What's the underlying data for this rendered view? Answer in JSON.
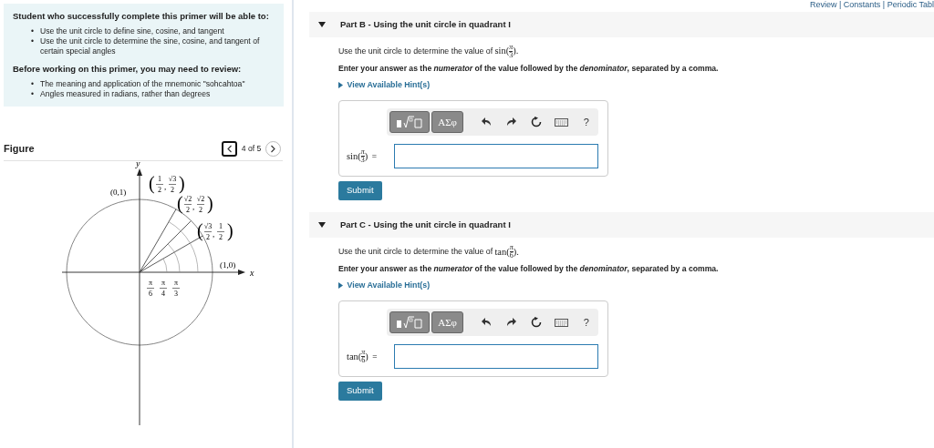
{
  "objectives": {
    "heading": "Student who successfully complete this primer will be able to:",
    "items": [
      {
        "bullet": "•",
        "text": "Use the unit circle to define sine, cosine, and tangent"
      },
      {
        "bullet": "•",
        "text": "Use the unit circle to determine the sine, cosine, and tangent of certain special angles"
      }
    ]
  },
  "review": {
    "heading": "Before working on this primer, you may need to review:",
    "items": [
      {
        "bullet": "•",
        "text": "The meaning and application of the mnemonic \"sohcahtoa\""
      },
      {
        "bullet": "•",
        "text": "Angles measured in radians, rather than degrees"
      }
    ]
  },
  "figure": {
    "title": "Figure",
    "pager": "4 of 5",
    "prev_focused": true,
    "axis_labels": {
      "x": "x",
      "y": "y"
    },
    "axis_points": [
      {
        "text": "(0,1)"
      },
      {
        "text": "(1,0)"
      }
    ],
    "points": [
      {
        "open": "(",
        "x_num": "1",
        "x_den": "2",
        "sep": ",",
        "y_num": "√3",
        "y_den": "2",
        "close": ")"
      },
      {
        "open": "(",
        "x_num": "√2",
        "x_den": "2",
        "sep": ",",
        "y_num": "√2",
        "y_den": "2",
        "close": ")"
      },
      {
        "open": "(",
        "x_num": "√3",
        "x_den": "2",
        "sep": ",",
        "y_num": "1",
        "y_den": "2",
        "close": ")"
      }
    ],
    "angles": [
      {
        "num": "π",
        "den": "6"
      },
      {
        "num": "π",
        "den": "4"
      },
      {
        "num": "π",
        "den": "3"
      }
    ]
  },
  "top_links": "Review | Constants | Periodic Tabl",
  "parts": [
    {
      "title": "Part B - Using the unit circle in quadrant I",
      "expanded": true,
      "prompt": "Use the unit circle to determine the value of",
      "prompt_math": {
        "func": "sin(",
        "num": "π",
        "den": "3",
        "close": ")."
      },
      "instruction": "Enter your answer as the *numerator* of the value followed by the *denominator*, separated by a comma.",
      "hint": "View Available Hint(s)",
      "symbols": "ΑΣφ",
      "help": "?",
      "label_math": {
        "func": "sin(",
        "num": "π",
        "den": "3",
        "close": ")"
      },
      "equals": "=",
      "submit": "Submit"
    },
    {
      "title": "Part C - Using the unit circle in quadrant I",
      "expanded": true,
      "prompt": "Use the unit circle to determine the value of",
      "prompt_math": {
        "func": "tan(",
        "num": "π",
        "den": "6",
        "close": ")."
      },
      "instruction": "Enter your answer as the *numerator* of the value followed by the *denominator*, separated by a comma.",
      "hint": "View Available Hint(s)",
      "symbols": "ΑΣφ",
      "help": "?",
      "label_math": {
        "func": "tan(",
        "num": "π",
        "den": "6",
        "close": ")"
      },
      "equals": "=",
      "submit": "Submit"
    }
  ]
}
